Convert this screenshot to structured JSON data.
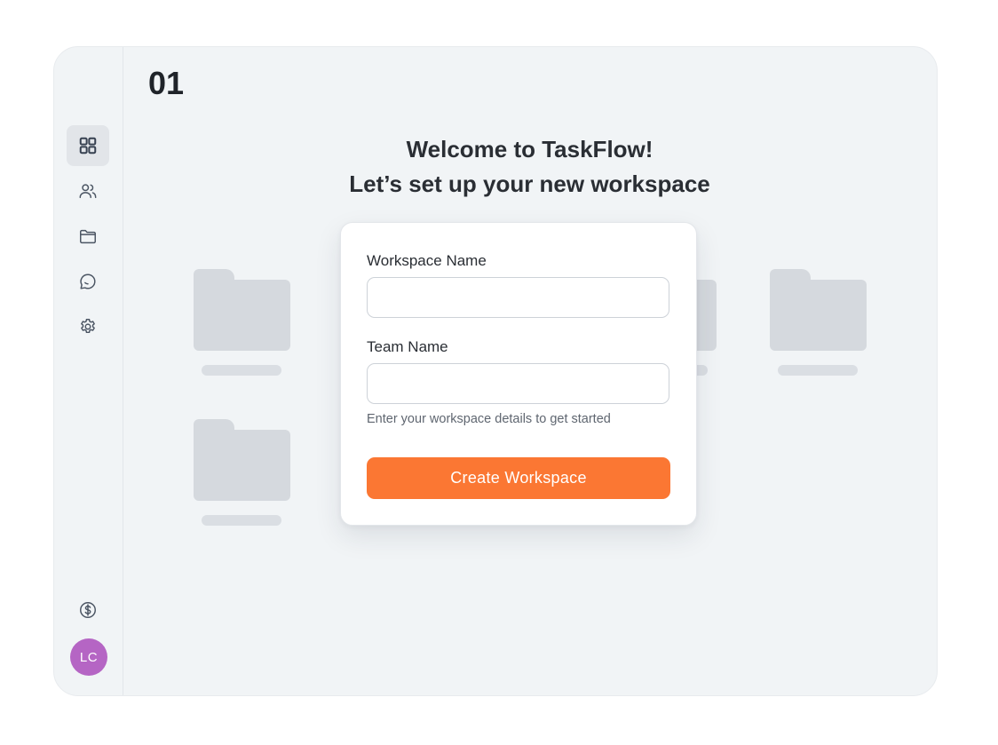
{
  "step": "01",
  "welcome": {
    "line1": "Welcome to TaskFlow!",
    "line2": "Let’s set up your new workspace"
  },
  "sidebar": {
    "items": [
      {
        "icon": "dashboard-grid-icon",
        "active": true
      },
      {
        "icon": "users-icon",
        "active": false
      },
      {
        "icon": "folder-icon",
        "active": false
      },
      {
        "icon": "chat-bubble-icon",
        "active": false
      },
      {
        "icon": "settings-gear-icon",
        "active": false
      }
    ],
    "billing_icon": "dollar-circle-icon",
    "avatar_initials": "LC",
    "avatar_color": "#b565c4"
  },
  "form": {
    "workspace_name_label": "Workspace Name",
    "workspace_name_value": "",
    "team_name_label": "Team Name",
    "team_name_value": "",
    "helper": "Enter your workspace details to get started",
    "submit_label": "Create Workspace"
  },
  "colors": {
    "accent": "#fb7733",
    "background": "#f1f4f6",
    "placeholder_folder": "#d5d9de"
  }
}
